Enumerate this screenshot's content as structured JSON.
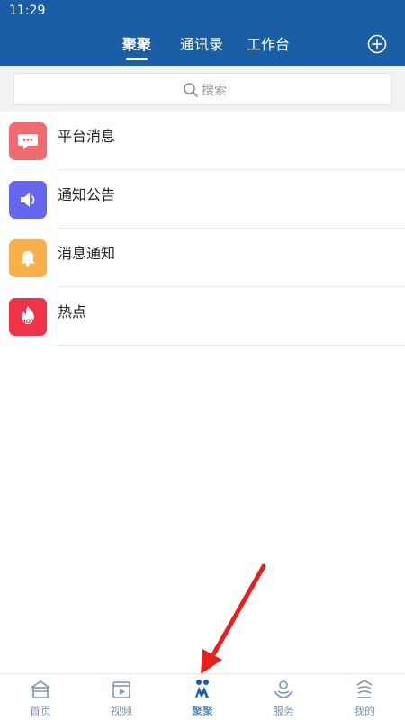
{
  "status_bar": {
    "time": "11:29"
  },
  "header": {
    "tabs": [
      {
        "label": "聚聚",
        "active": true
      },
      {
        "label": "通讯录",
        "active": false
      },
      {
        "label": "工作台",
        "active": false
      }
    ],
    "add_icon": "plus-circle-icon"
  },
  "search": {
    "placeholder": "搜索",
    "icon": "search-icon"
  },
  "list": [
    {
      "title": "平台消息",
      "icon": "chat-bubble-icon",
      "color": "#f06b70"
    },
    {
      "title": "通知公告",
      "icon": "speaker-icon",
      "color": "#6666ee"
    },
    {
      "title": "消息通知",
      "icon": "bell-icon",
      "color": "#f9b04a"
    },
    {
      "title": "热点",
      "icon": "hot-fire-icon",
      "color": "#ef3348"
    }
  ],
  "bottom_nav": [
    {
      "label": "首页",
      "icon": "home-icon",
      "active": false
    },
    {
      "label": "视频",
      "icon": "video-icon",
      "active": false
    },
    {
      "label": "聚聚",
      "icon": "people-icon",
      "active": true
    },
    {
      "label": "服务",
      "icon": "service-icon",
      "active": false
    },
    {
      "label": "我的",
      "icon": "profile-icon",
      "active": false
    }
  ],
  "colors": {
    "header_bg": "#1a5fa6",
    "nav_inactive": "#7a94b4",
    "nav_active": "#1a5fa6",
    "annotation_arrow": "#e8201b"
  }
}
